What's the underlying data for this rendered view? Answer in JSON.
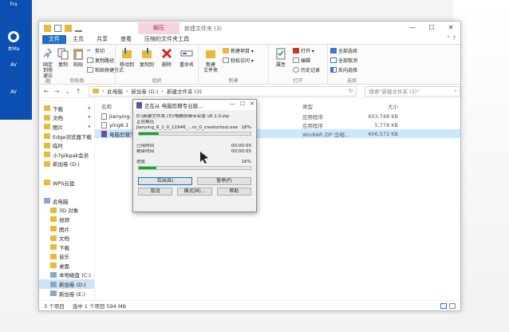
{
  "desktop": {
    "icons": [
      {
        "label": "Fra"
      },
      {
        "label": "本Ma"
      },
      {
        "label": "AV"
      },
      {
        "label": "AV"
      }
    ]
  },
  "window": {
    "context_tab": "解压",
    "title": "新建文件夹 (3)",
    "menus": [
      "文件",
      "主页",
      "共享",
      "查看",
      "压缩的文件夹工具"
    ],
    "ribbon": {
      "clipboard": {
        "label": "剪贴板",
        "pin": "固定到快速访问",
        "copy": "复制",
        "paste": "粘贴",
        "cut": "剪切",
        "copy_path": "复制路径",
        "paste_shortcut": "粘贴快捷方式"
      },
      "organize": {
        "label": "组织",
        "move_to": "移动到",
        "copy_to": "复制到",
        "delete": "删除",
        "rename": "重命名"
      },
      "new": {
        "label": "新建",
        "new_folder": "新建\n文件夹",
        "new_item": "新建项目 ▾",
        "easy_access": "轻松访问 ▾"
      },
      "open": {
        "label": "打开",
        "properties": "属性",
        "open": "打开 ▾",
        "edit": "编辑",
        "history": "历史记录"
      },
      "select": {
        "label": "选择",
        "select_all": "全部选择",
        "select_none": "全部取消",
        "invert": "反向选择"
      }
    },
    "address": {
      "parts": [
        "此电脑",
        "新加卷 (D:)",
        "新建文件夹 (3)"
      ],
      "search_placeholder": "搜索\"新建文件夹 (3)\""
    },
    "nav": [
      {
        "label": "下载",
        "pin": "★"
      },
      {
        "label": "文档",
        "pin": "★"
      },
      {
        "label": "图片",
        "pin": "★"
      },
      {
        "label": "Edge浏览器下载"
      },
      {
        "label": "临时"
      },
      {
        "label": "小7pikpak会员"
      },
      {
        "label": "新加卷 (D:)"
      },
      {
        "label": ""
      },
      {
        "label": "WPS云盘"
      },
      {
        "label": ""
      },
      {
        "label": "此电脑"
      },
      {
        "label": "3D 对象"
      },
      {
        "label": "视频"
      },
      {
        "label": "图片"
      },
      {
        "label": "文档"
      },
      {
        "label": "下载"
      },
      {
        "label": "音乐"
      },
      {
        "label": "桌面"
      },
      {
        "label": "本地磁盘 (C:)"
      },
      {
        "label": "新加卷 (D:)",
        "selected": true
      },
      {
        "label": "新加卷 (E:)"
      }
    ],
    "columns": {
      "name": "名称",
      "type": "类型",
      "size": "大小"
    },
    "files": [
      {
        "name": "Jianying",
        "type": "应用程序",
        "size": "603,748 KB"
      },
      {
        "name": "ying6.1",
        "type": "应用程序",
        "size": "5,778 KB"
      },
      {
        "name": "电脑剪辑下",
        "type": "WinRAR ZIP 压缩...",
        "size": "606,572 KB",
        "selected": true
      }
    ],
    "status": {
      "count": "3 个项目",
      "selected": "选中 1 个项目  594 MB"
    }
  },
  "dialog": {
    "title": "正在从 电脑剪辑专业版...",
    "archive_path": "D:\\新建文件夹 (3)\\电脑剪辑专业版 v6.1.0.zip",
    "status": "正在解压",
    "current_file": "Jianying_6_1_0_11946_...ro_0_creatortool.exe",
    "file_percent": "18%",
    "file_progress": 0.18,
    "elapsed_label": "已用时间",
    "elapsed": "00:00:00",
    "remaining_label": "剩余时间",
    "remaining": "00:00:05",
    "progress_label": "进度",
    "total_percent": "16%",
    "total_progress": 0.16,
    "buttons": {
      "background": "后台(B)",
      "pause": "暂停(P)",
      "cancel": "取消",
      "mode": "模式(M)...",
      "help": "帮助"
    }
  }
}
